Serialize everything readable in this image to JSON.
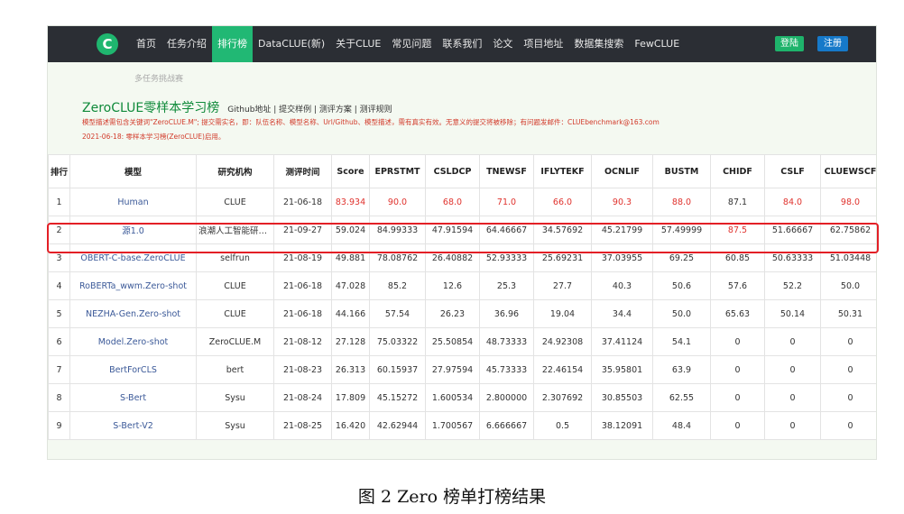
{
  "nav": {
    "items": [
      "首页",
      "任务介绍",
      "排行榜",
      "DataCLUE(新)",
      "关于CLUE",
      "常见问题",
      "联系我们",
      "论文",
      "项目地址",
      "数据集搜索",
      "FewCLUE"
    ],
    "active_index": 2,
    "login": "登陆",
    "register": "注册"
  },
  "subtab": "多任务挑战赛",
  "title": "ZeroCLUE零样本学习榜",
  "links": "Github地址 | 提交样例 | 测评方案 | 测评规则",
  "note": "模型描述需包含关键词\"ZeroCLUE.M\"; 提交需实名，即：队伍名称、模型名称、Url/Github、模型描述，需有真实有效。无意义的提交将被移除；有问题发邮件：CLUEbenchmark@163.com",
  "note2": "2021-06-18: 零样本学习榜(ZeroCLUE)启用。",
  "table": {
    "headers": [
      "排行",
      "模型",
      "研究机构",
      "测评时间",
      "Score",
      "EPRSTMT",
      "CSLDCP",
      "TNEWSF",
      "IFLYTEKF",
      "OCNLIF",
      "BUSTM",
      "CHIDF",
      "CSLF",
      "CLUEWSCF"
    ],
    "rows": [
      [
        "1",
        "Human",
        "CLUE",
        "21-06-18",
        "83.934",
        "90.0",
        "68.0",
        "71.0",
        "66.0",
        "90.3",
        "88.0",
        "87.1",
        "84.0",
        "98.0"
      ],
      [
        "2",
        "源1.0",
        "浪潮人工智能研究院",
        "21-09-27",
        "59.024",
        "84.99333",
        "47.91594",
        "64.46667",
        "34.57692",
        "45.21799",
        "57.49999",
        "87.5",
        "51.66667",
        "62.75862"
      ],
      [
        "3",
        "OBERT-C-base.ZeroCLUE",
        "selfrun",
        "21-08-19",
        "49.881",
        "78.08762",
        "26.40882",
        "52.93333",
        "25.69231",
        "37.03955",
        "69.25",
        "60.85",
        "50.63333",
        "51.03448"
      ],
      [
        "4",
        "RoBERTa_wwm.Zero-shot",
        "CLUE",
        "21-06-18",
        "47.028",
        "85.2",
        "12.6",
        "25.3",
        "27.7",
        "40.3",
        "50.6",
        "57.6",
        "52.2",
        "50.0"
      ],
      [
        "5",
        "NEZHA-Gen.Zero-shot",
        "CLUE",
        "21-06-18",
        "44.166",
        "57.54",
        "26.23",
        "36.96",
        "19.04",
        "34.4",
        "50.0",
        "65.63",
        "50.14",
        "50.31"
      ],
      [
        "6",
        "Model.Zero-shot",
        "ZeroCLUE.M",
        "21-08-12",
        "27.128",
        "75.03322",
        "25.50854",
        "48.73333",
        "24.92308",
        "37.41124",
        "54.1",
        "0",
        "0",
        "0"
      ],
      [
        "7",
        "BertForCLS",
        "bert",
        "21-08-23",
        "26.313",
        "60.15937",
        "27.97594",
        "45.73333",
        "22.46154",
        "35.95801",
        "63.9",
        "0",
        "0",
        "0"
      ],
      [
        "8",
        "S-Bert",
        "Sysu",
        "21-08-24",
        "17.809",
        "45.15272",
        "1.600534",
        "2.800000",
        "2.307692",
        "30.85503",
        "62.55",
        "0",
        "0",
        "0"
      ],
      [
        "9",
        "S-Bert-V2",
        "Sysu",
        "21-08-25",
        "16.420",
        "42.62944",
        "1.700567",
        "6.666667",
        "0.5",
        "38.12091",
        "48.4",
        "0",
        "0",
        "0"
      ]
    ]
  },
  "caption": "图 2 Zero 榜单打榜结果",
  "colors": {
    "nav_bg": "#2b2e34",
    "accent_green": "#21b874",
    "register_blue": "#1679c9",
    "highlight_red": "#e31f26",
    "human_red": "#e0322d"
  }
}
